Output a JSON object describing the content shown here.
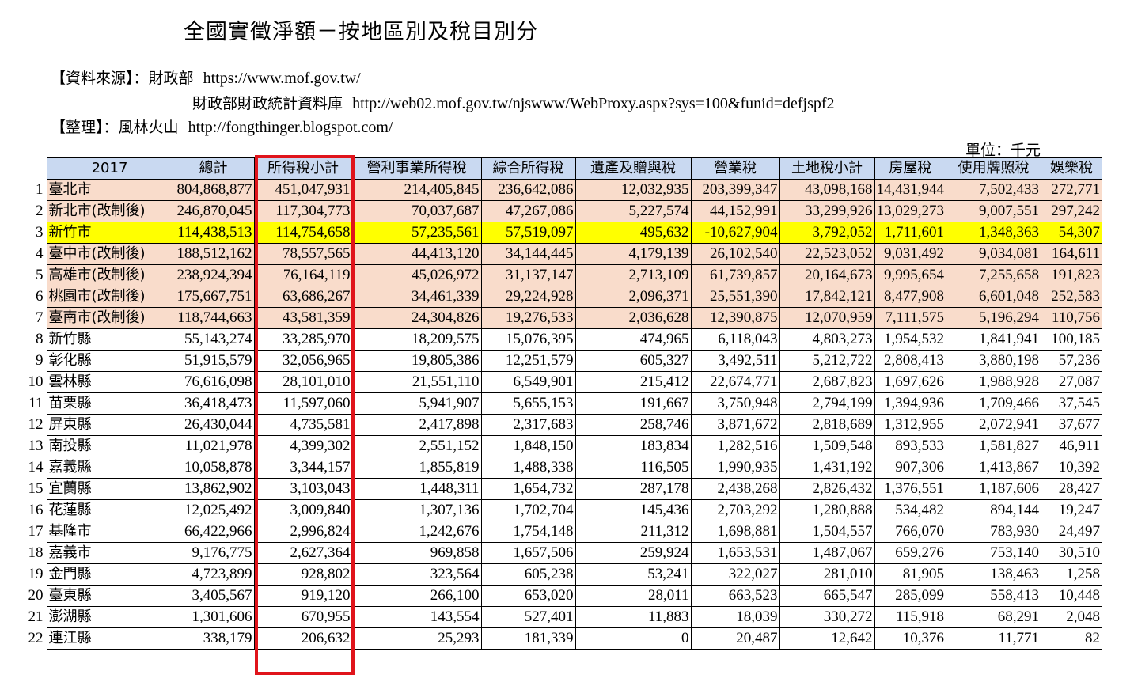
{
  "title": "全國實徵淨額－按地區別及稅目別分",
  "source": {
    "label": "【資料來源】：財政部",
    "url1": "https://www.mof.gov.tw/",
    "label2": "財政部財政統計資料庫",
    "url2": "http://web02.mof.gov.tw/njswww/WebProxy.aspx?sys=100&funid=defjspf2",
    "editor_label": "【整理】：風林火山",
    "editor_url": "http://fongthinger.blogspot.com/"
  },
  "unit": "單位：千元",
  "table": {
    "headers": [
      "2017",
      "總計",
      "所得稅小計",
      "營利事業所得稅",
      "綜合所得稅",
      "遺產及贈與稅",
      "營業稅",
      "土地稅小計",
      "房屋稅",
      "使用牌照稅",
      "娛樂稅"
    ],
    "rows": [
      {
        "n": "1",
        "style": "metro",
        "cells": [
          "臺北市",
          "804,868,877",
          "451,047,931",
          "214,405,845",
          "236,642,086",
          "12,032,935",
          "203,399,347",
          "43,098,168",
          "14,431,944",
          "7,502,433",
          "272,771"
        ]
      },
      {
        "n": "2",
        "style": "metro",
        "cells": [
          "新北市(改制後)",
          "246,870,045",
          "117,304,773",
          "70,037,687",
          "47,267,086",
          "5,227,574",
          "44,152,991",
          "33,299,926",
          "13,029,273",
          "9,007,551",
          "297,242"
        ]
      },
      {
        "n": "3",
        "style": "hilite",
        "cells": [
          "新竹市",
          "114,438,513",
          "114,754,658",
          "57,235,561",
          "57,519,097",
          "495,632",
          "-10,627,904",
          "3,792,052",
          "1,711,601",
          "1,348,363",
          "54,307"
        ]
      },
      {
        "n": "4",
        "style": "metro",
        "cells": [
          "臺中市(改制後)",
          "188,512,162",
          "78,557,565",
          "44,413,120",
          "34,144,445",
          "4,179,139",
          "26,102,540",
          "22,523,052",
          "9,031,492",
          "9,034,081",
          "164,611"
        ]
      },
      {
        "n": "5",
        "style": "metro",
        "cells": [
          "高雄市(改制後)",
          "238,924,394",
          "76,164,119",
          "45,026,972",
          "31,137,147",
          "2,713,109",
          "61,739,857",
          "20,164,673",
          "9,995,654",
          "7,255,658",
          "191,823"
        ]
      },
      {
        "n": "6",
        "style": "metro",
        "cells": [
          "桃園市(改制後)",
          "175,667,751",
          "63,686,267",
          "34,461,339",
          "29,224,928",
          "2,096,371",
          "25,551,390",
          "17,842,121",
          "8,477,908",
          "6,601,048",
          "252,583"
        ]
      },
      {
        "n": "7",
        "style": "metro",
        "cells": [
          "臺南市(改制後)",
          "118,744,663",
          "43,581,359",
          "24,304,826",
          "19,276,533",
          "2,036,628",
          "12,390,875",
          "12,070,959",
          "7,111,575",
          "5,196,294",
          "110,756"
        ]
      },
      {
        "n": "8",
        "style": "",
        "cells": [
          "新竹縣",
          "55,143,274",
          "33,285,970",
          "18,209,575",
          "15,076,395",
          "474,965",
          "6,118,043",
          "4,803,273",
          "1,954,532",
          "1,841,941",
          "100,185"
        ]
      },
      {
        "n": "9",
        "style": "",
        "cells": [
          "彰化縣",
          "51,915,579",
          "32,056,965",
          "19,805,386",
          "12,251,579",
          "605,327",
          "3,492,511",
          "5,212,722",
          "2,808,413",
          "3,880,198",
          "57,236"
        ]
      },
      {
        "n": "10",
        "style": "",
        "cells": [
          "雲林縣",
          "76,616,098",
          "28,101,010",
          "21,551,110",
          "6,549,901",
          "215,412",
          "22,674,771",
          "2,687,823",
          "1,697,626",
          "1,988,928",
          "27,087"
        ]
      },
      {
        "n": "11",
        "style": "",
        "cells": [
          "苗栗縣",
          "36,418,473",
          "11,597,060",
          "5,941,907",
          "5,655,153",
          "191,667",
          "3,750,948",
          "2,794,199",
          "1,394,936",
          "1,709,466",
          "37,545"
        ]
      },
      {
        "n": "12",
        "style": "",
        "cells": [
          "屏東縣",
          "26,430,044",
          "4,735,581",
          "2,417,898",
          "2,317,683",
          "258,746",
          "3,871,672",
          "2,818,689",
          "1,312,955",
          "2,072,941",
          "37,677"
        ]
      },
      {
        "n": "13",
        "style": "",
        "cells": [
          "南投縣",
          "11,021,978",
          "4,399,302",
          "2,551,152",
          "1,848,150",
          "183,834",
          "1,282,516",
          "1,509,548",
          "893,533",
          "1,581,827",
          "46,911"
        ]
      },
      {
        "n": "14",
        "style": "",
        "cells": [
          "嘉義縣",
          "10,058,878",
          "3,344,157",
          "1,855,819",
          "1,488,338",
          "116,505",
          "1,990,935",
          "1,431,192",
          "907,306",
          "1,413,867",
          "10,392"
        ]
      },
      {
        "n": "15",
        "style": "",
        "cells": [
          "宜蘭縣",
          "13,862,902",
          "3,103,043",
          "1,448,311",
          "1,654,732",
          "287,178",
          "2,438,268",
          "2,826,432",
          "1,376,551",
          "1,187,606",
          "28,427"
        ]
      },
      {
        "n": "16",
        "style": "",
        "cells": [
          "花蓮縣",
          "12,025,492",
          "3,009,840",
          "1,307,136",
          "1,702,704",
          "145,436",
          "2,703,292",
          "1,280,888",
          "534,482",
          "894,144",
          "19,247"
        ]
      },
      {
        "n": "17",
        "style": "",
        "cells": [
          "基隆市",
          "66,422,966",
          "2,996,824",
          "1,242,676",
          "1,754,148",
          "211,312",
          "1,698,881",
          "1,504,557",
          "766,070",
          "783,930",
          "24,497"
        ]
      },
      {
        "n": "18",
        "style": "",
        "cells": [
          "嘉義市",
          "9,176,775",
          "2,627,364",
          "969,858",
          "1,657,506",
          "259,924",
          "1,653,531",
          "1,487,067",
          "659,276",
          "753,140",
          "30,510"
        ]
      },
      {
        "n": "19",
        "style": "",
        "cells": [
          "金門縣",
          "4,723,899",
          "928,802",
          "323,564",
          "605,238",
          "53,241",
          "322,027",
          "281,010",
          "81,905",
          "138,463",
          "1,258"
        ]
      },
      {
        "n": "20",
        "style": "",
        "cells": [
          "臺東縣",
          "3,405,567",
          "919,120",
          "266,100",
          "653,020",
          "28,011",
          "663,523",
          "665,547",
          "285,099",
          "558,413",
          "10,448"
        ]
      },
      {
        "n": "21",
        "style": "",
        "cells": [
          "澎湖縣",
          "1,301,606",
          "670,955",
          "143,554",
          "527,401",
          "11,883",
          "18,039",
          "330,272",
          "115,918",
          "68,291",
          "2,048"
        ]
      },
      {
        "n": "22",
        "style": "",
        "cells": [
          "連江縣",
          "338,179",
          "206,632",
          "25,293",
          "181,339",
          "0",
          "20,487",
          "12,642",
          "10,376",
          "11,771",
          "82"
        ]
      }
    ]
  },
  "colors": {
    "header_bg": "#c9d9f1",
    "metro_bg": "#f9dccb",
    "highlight_bg": "#ffff00",
    "highlight_box": "#e0141b"
  }
}
